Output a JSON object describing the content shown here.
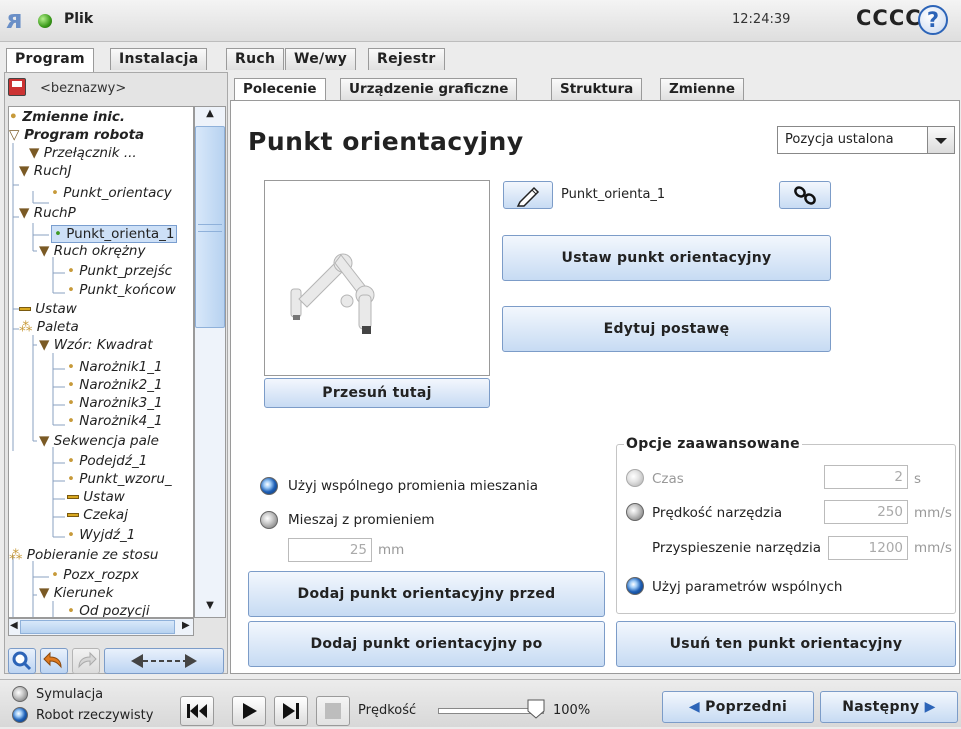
{
  "header": {
    "file_label": "Plik",
    "clock": "12:24:39",
    "robot_name": "CCCC",
    "help": "?"
  },
  "main_tabs": [
    {
      "label": "Program",
      "active": true
    },
    {
      "label": "Instalacja",
      "active": false
    },
    {
      "label": "Ruch",
      "active": false
    },
    {
      "label": "We/wy",
      "active": false
    },
    {
      "label": "Rejestr",
      "active": false
    }
  ],
  "program_name": "<beznazwy>",
  "tree": [
    {
      "text": "Zmienne inic.",
      "bold": true
    },
    {
      "text": "Program robota",
      "bold": true
    },
    {
      "text": "Przełącznik ..."
    },
    {
      "text": "RuchJ"
    },
    {
      "text": "Punkt_orientacy"
    },
    {
      "text": "RuchP"
    },
    {
      "text": "Punkt_orienta_1",
      "selected": true
    },
    {
      "text": "Ruch okrężny"
    },
    {
      "text": "Punkt_przejśc"
    },
    {
      "text": "Punkt_końcow"
    },
    {
      "text": "Ustaw"
    },
    {
      "text": "Paleta"
    },
    {
      "text": "Wzór: Kwadrat"
    },
    {
      "text": "Narożnik1_1"
    },
    {
      "text": "Narożnik2_1"
    },
    {
      "text": "Narożnik3_1"
    },
    {
      "text": "Narożnik4_1"
    },
    {
      "text": "Sekwencja pale"
    },
    {
      "text": "Podejdź_1"
    },
    {
      "text": "Punkt_wzoru_"
    },
    {
      "text": "Ustaw"
    },
    {
      "text": "Czekaj"
    },
    {
      "text": "Wyjdź_1"
    },
    {
      "text": "Pobieranie ze stosu"
    },
    {
      "text": "Pozx_rozpx"
    },
    {
      "text": "Kierunek"
    },
    {
      "text": "Od pozycji"
    }
  ],
  "sub_tabs": [
    {
      "label": "Polecenie",
      "active": true
    },
    {
      "label": "Urządzenie graficzne",
      "active": false
    },
    {
      "label": "Struktura",
      "active": false
    },
    {
      "label": "Zmienne",
      "active": false
    }
  ],
  "command": {
    "title": "Punkt orientacyjny",
    "position_mode": "Pozycja ustalona",
    "waypoint_name": "Punkt_orienta_1",
    "move_here": "Przesuń tutaj",
    "set_waypoint": "Ustaw punkt orientacyjny",
    "edit_pose": "Edytuj postawę",
    "blend_shared": "Użyj wspólnego promienia mieszania",
    "blend_radius": "Mieszaj z promieniem",
    "blend_value": "25",
    "blend_unit": "mm",
    "add_before": "Dodaj punkt orientacyjny przed",
    "add_after": "Dodaj punkt orientacyjny po",
    "delete": "Usuń ten punkt orientacyjny"
  },
  "advanced": {
    "title": "Opcje zaawansowane",
    "time_label": "Czas",
    "time_value": "2",
    "time_unit": "s",
    "tool_speed_label": "Prędkość narzędzia",
    "tool_speed_value": "250",
    "tool_speed_unit": "mm/s",
    "tool_accel_label": "Przyspieszenie narzędzia",
    "tool_accel_value": "1200",
    "tool_accel_unit": "mm/s",
    "shared_params_label": "Użyj parametrów wspólnych"
  },
  "footer": {
    "simulation": "Symulacja",
    "real_robot": "Robot rzeczywisty",
    "speed_label": "Prędkość",
    "speed_value": "100%",
    "speed_fraction": 1.0,
    "prev": "Poprzedni",
    "next": "Następny"
  },
  "colors": {
    "accent": "#2c64b8",
    "button_top": "#f3f7fd",
    "button_bottom": "#c7dbf3",
    "status_green": "#3a9a1a"
  }
}
